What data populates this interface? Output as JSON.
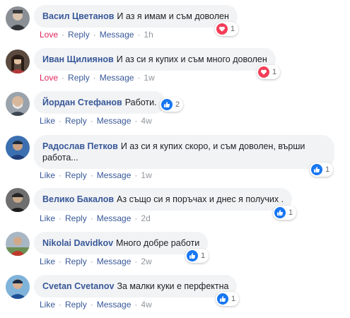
{
  "comments": [
    {
      "author": "Васил Цветанов",
      "text": "И аз я имам и съм доволен",
      "action": "Love",
      "reply": "Reply",
      "message": "Message",
      "time": "1h",
      "reaction_type": "love",
      "reaction_count": "1"
    },
    {
      "author": "Иван Щилиянов",
      "text": "И аз си я купих и съм много доволен",
      "action": "Love",
      "reply": "Reply",
      "message": "Message",
      "time": "1w",
      "reaction_type": "love",
      "reaction_count": "1"
    },
    {
      "author": "Йордан Стефанов",
      "text": "Работи.",
      "action": "Like",
      "reply": "Reply",
      "message": "Message",
      "time": "4w",
      "reaction_type": "like",
      "reaction_count": "2"
    },
    {
      "author": "Радослав Петков",
      "text": "И аз си я купих скоро, и съм доволен, върши работа...",
      "action": "Like",
      "reply": "Reply",
      "message": "Message",
      "time": "1w",
      "reaction_type": "like",
      "reaction_count": "1"
    },
    {
      "author": "Велико Бакалов",
      "text": "Аз също си я поръчах и днес я получих .",
      "action": "Like",
      "reply": "Reply",
      "message": "Message",
      "time": "2d",
      "reaction_type": "like",
      "reaction_count": "1"
    },
    {
      "author": "Nikolai Davidkov",
      "text": "Много добре работи",
      "action": "Like",
      "reply": "Reply",
      "message": "Message",
      "time": "2w",
      "reaction_type": "like",
      "reaction_count": "1"
    },
    {
      "author": "Cvetan Cvetanov",
      "text": "За малки куки е перфектна",
      "action": "Like",
      "reply": "Reply",
      "message": "Message",
      "time": "4w",
      "reaction_type": "like",
      "reaction_count": "1"
    }
  ],
  "colors": {
    "author": "#385898",
    "like": "#385898",
    "love": "#e0245e",
    "bubble": "#f2f3f5",
    "meta": "#90949c",
    "like_badge": "#1877f2",
    "love_badge": "#f33e58"
  },
  "icons": {
    "like": "thumbs-up-icon",
    "love": "heart-icon"
  }
}
